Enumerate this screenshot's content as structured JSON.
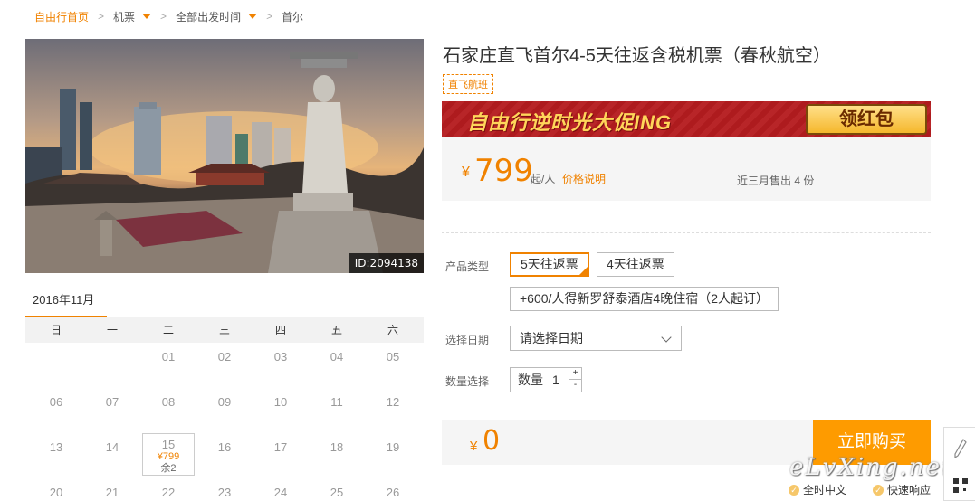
{
  "breadcrumb": {
    "home": "自由行首页",
    "category": "机票",
    "departure": "全部出发时间",
    "destination": "首尔",
    "separator": ">"
  },
  "photo": {
    "id_label": "ID:2094138"
  },
  "calendar": {
    "month": "2016年11月",
    "weekdays": [
      "日",
      "一",
      "二",
      "三",
      "四",
      "五",
      "六"
    ],
    "days": [
      "",
      "",
      "01",
      "02",
      "03",
      "04",
      "05",
      "06",
      "07",
      "08",
      "09",
      "10",
      "11",
      "12",
      "13",
      "14",
      "15",
      "16",
      "17",
      "18",
      "19",
      "20",
      "21",
      "22",
      "23",
      "24",
      "25",
      "26"
    ],
    "selected": {
      "day": "15",
      "price": "¥799",
      "remaining": "余2"
    }
  },
  "product": {
    "title": "石家庄直飞首尔4-5天往返含税机票（春秋航空）",
    "tag": "直飞航班"
  },
  "banner": {
    "text": "自由行逆时光大促ING",
    "button": "领红包"
  },
  "price": {
    "currency": "¥",
    "amount": "799",
    "unit": "起/人",
    "explain_link": "价格说明",
    "sold": "近三月售出 4 份"
  },
  "options": {
    "type_label": "产品类型",
    "types": [
      "5天往返票",
      "4天往返票"
    ],
    "selected_type": "5天往返票",
    "addon": "+600/人得新罗舒泰酒店4晚住宿（2人起订）",
    "date_label": "选择日期",
    "date_placeholder": "请选择日期",
    "qty_label": "数量选择",
    "qty_prefix": "数量",
    "qty_value": "1",
    "plus": "+",
    "minus": "-"
  },
  "total": {
    "currency": "¥",
    "amount": "0"
  },
  "buy_button": "立即购买",
  "badges": [
    "全时中文",
    "快速响应"
  ],
  "watermark": "eLvXing.net",
  "colors": {
    "accent": "#f08200",
    "buy": "#fe9b00",
    "banner": "#b51c1f"
  }
}
